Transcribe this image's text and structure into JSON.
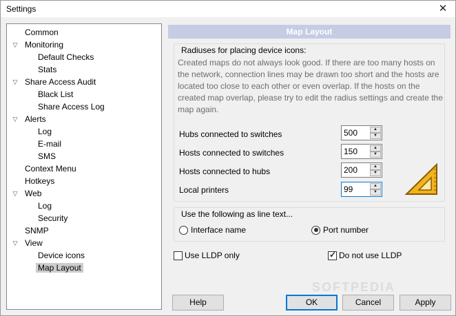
{
  "window": {
    "title": "Settings",
    "close_glyph": "✕"
  },
  "tree": [
    {
      "label": "Common",
      "level": 0,
      "expander": false,
      "selected": false
    },
    {
      "label": "Monitoring",
      "level": 0,
      "expander": true,
      "selected": false
    },
    {
      "label": "Default Checks",
      "level": 1,
      "expander": false,
      "selected": false
    },
    {
      "label": "Stats",
      "level": 1,
      "expander": false,
      "selected": false
    },
    {
      "label": "Share Access Audit",
      "level": 0,
      "expander": true,
      "selected": false
    },
    {
      "label": "Black List",
      "level": 1,
      "expander": false,
      "selected": false
    },
    {
      "label": "Share Access Log",
      "level": 1,
      "expander": false,
      "selected": false
    },
    {
      "label": "Alerts",
      "level": 0,
      "expander": true,
      "selected": false
    },
    {
      "label": "Log",
      "level": 1,
      "expander": false,
      "selected": false
    },
    {
      "label": "E-mail",
      "level": 1,
      "expander": false,
      "selected": false
    },
    {
      "label": "SMS",
      "level": 1,
      "expander": false,
      "selected": false
    },
    {
      "label": "Context Menu",
      "level": 0,
      "expander": false,
      "selected": false
    },
    {
      "label": "Hotkeys",
      "level": 0,
      "expander": false,
      "selected": false
    },
    {
      "label": "Web",
      "level": 0,
      "expander": true,
      "selected": false
    },
    {
      "label": "Log",
      "level": 1,
      "expander": false,
      "selected": false
    },
    {
      "label": "Security",
      "level": 1,
      "expander": false,
      "selected": false
    },
    {
      "label": "SNMP",
      "level": 0,
      "expander": false,
      "selected": false
    },
    {
      "label": "View",
      "level": 0,
      "expander": true,
      "selected": false
    },
    {
      "label": "Device icons",
      "level": 1,
      "expander": false,
      "selected": false
    },
    {
      "label": "Map Layout",
      "level": 1,
      "expander": false,
      "selected": true
    }
  ],
  "panel": {
    "header": "Map Layout",
    "radius_group": {
      "title": "Radiuses for placing device icons:",
      "description": "Created maps do not always look good. If there are too many hosts on the network, connection lines may be drawn too short and the hosts are located too close to each other or even overlap. If the hosts on the created map overlap, please try to edit the radius settings and create the map again.",
      "fields": [
        {
          "label": "Hubs connected to switches",
          "value": "500"
        },
        {
          "label": "Hosts connected to switches",
          "value": "150"
        },
        {
          "label": "Hosts connected to hubs",
          "value": "200"
        },
        {
          "label": "Local printers",
          "value": "99"
        }
      ],
      "icon": "set-square-ruler-icon"
    },
    "line_text_group": {
      "title": "Use the following as line text...",
      "options": [
        {
          "label": "Interface name",
          "selected": false
        },
        {
          "label": "Port number",
          "selected": true
        }
      ]
    },
    "checkboxes": [
      {
        "label": "Use LLDP only",
        "checked": false
      },
      {
        "label": "Do not use LLDP",
        "checked": true
      }
    ]
  },
  "buttons": {
    "help": "Help",
    "ok": "OK",
    "cancel": "Cancel",
    "apply": "Apply"
  },
  "watermark": "SOFTPEDIA"
}
